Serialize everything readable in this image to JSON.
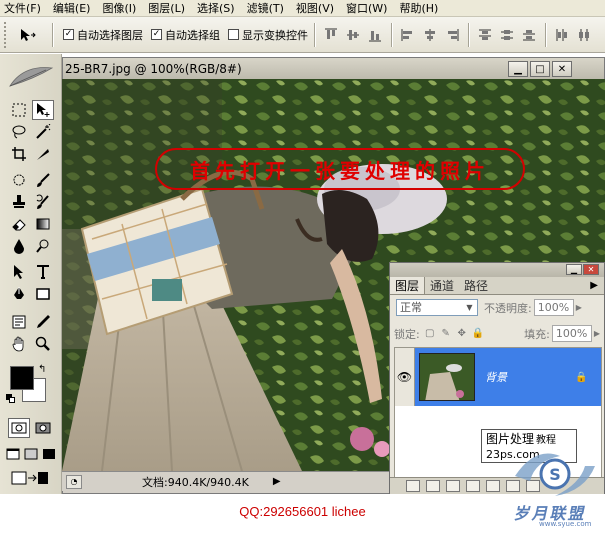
{
  "menu": [
    "文件(F)",
    "编辑(E)",
    "图像(I)",
    "图层(L)",
    "选择(S)",
    "滤镜(T)",
    "视图(V)",
    "窗口(W)",
    "帮助(H)"
  ],
  "options": {
    "auto_select_layer": "自动选择图层",
    "auto_select_group": "自动选择组",
    "show_transform": "显示变换控件",
    "auto_select_layer_checked": true,
    "auto_select_group_checked": true,
    "show_transform_checked": false
  },
  "document": {
    "title": "25-BR7.jpg @ 100%(RGB/8#)",
    "status": "文档:940.4K/940.4K",
    "callout": "首先打开一张要处理的照片"
  },
  "layers_panel": {
    "tabs": [
      "图层",
      "通道",
      "路径"
    ],
    "blend_mode": "正常",
    "opacity_label": "不透明度:",
    "opacity_value": "100%",
    "lock_label": "锁定:",
    "fill_label": "填充:",
    "fill_value": "100%",
    "layer_name": "背景"
  },
  "watermark": {
    "line1": "图片处理",
    "line2": "教程",
    "url": "23ps.com",
    "logo_text": "岁月联盟",
    "logo_sub": "www.syue.com"
  },
  "caption": "QQ:292656601 lichee",
  "colors": {
    "callout_red": "#e00000",
    "layer_selected": "#3e7fe8",
    "caption_red": "#cc0000"
  }
}
